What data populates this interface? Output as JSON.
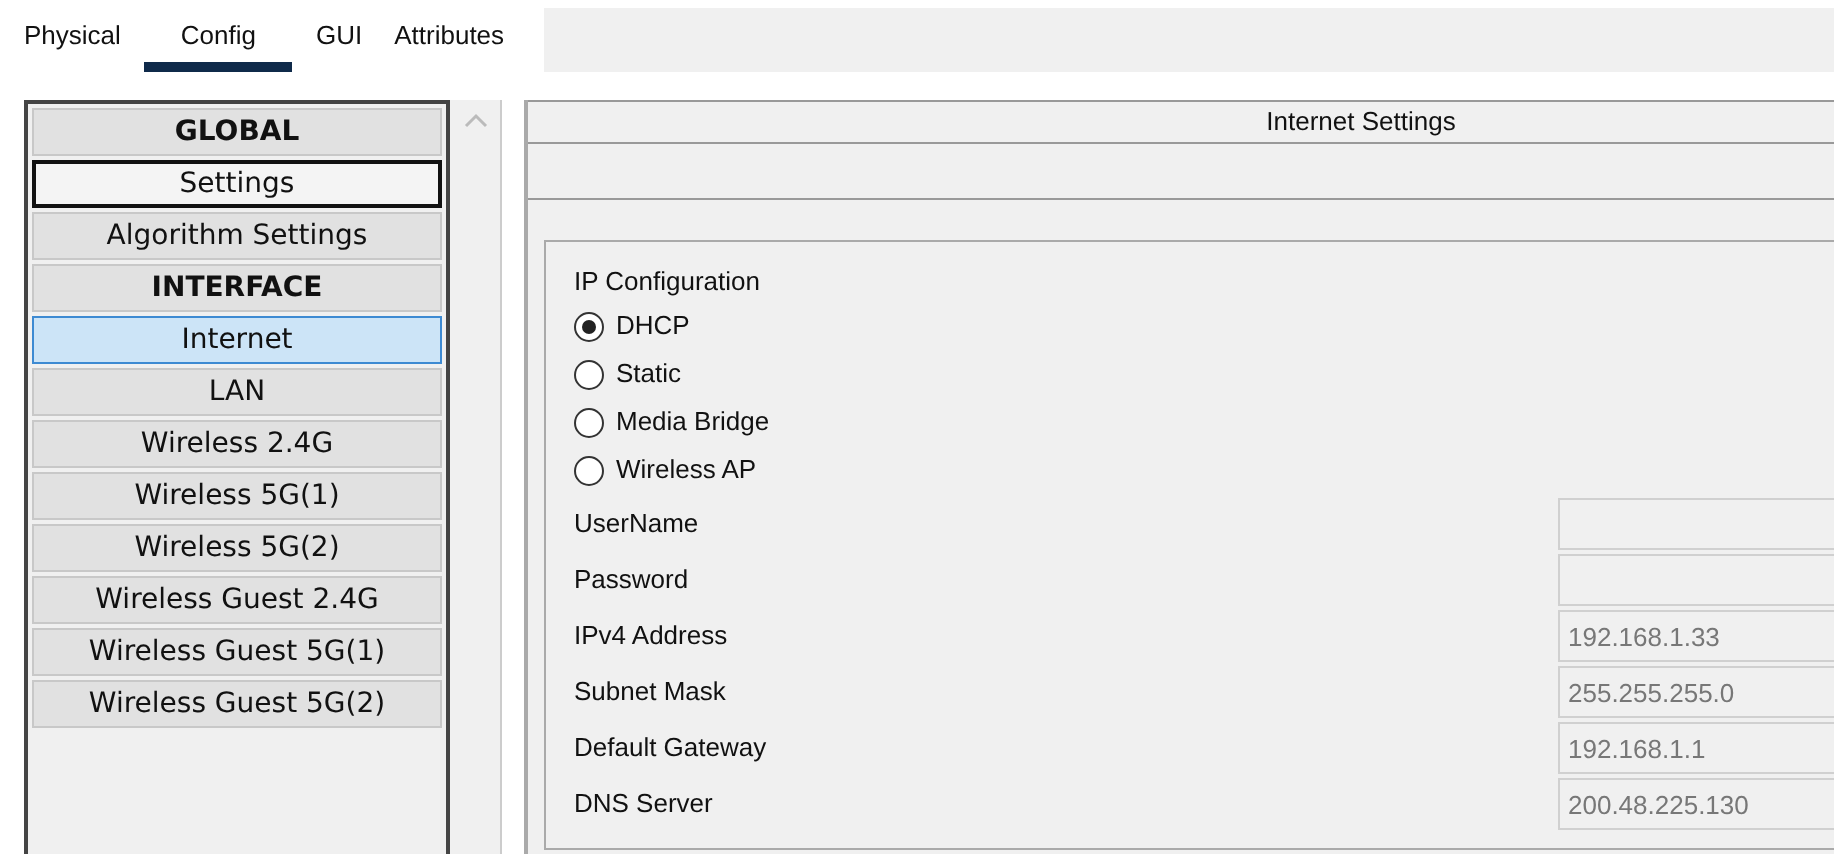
{
  "tabs": [
    {
      "label": "Physical",
      "selected": false
    },
    {
      "label": "Config",
      "selected": true
    },
    {
      "label": "GUI",
      "selected": false
    },
    {
      "label": "Attributes",
      "selected": false
    }
  ],
  "sidebar": {
    "items": [
      {
        "label": "GLOBAL",
        "kind": "header",
        "selected": false,
        "focused": false
      },
      {
        "label": "Settings",
        "kind": "item",
        "selected": false,
        "focused": true
      },
      {
        "label": "Algorithm Settings",
        "kind": "item",
        "selected": false,
        "focused": false
      },
      {
        "label": "INTERFACE",
        "kind": "header",
        "selected": false,
        "focused": false
      },
      {
        "label": "Internet",
        "kind": "item",
        "selected": true,
        "focused": false
      },
      {
        "label": "LAN",
        "kind": "item",
        "selected": false,
        "focused": false
      },
      {
        "label": "Wireless 2.4G",
        "kind": "item",
        "selected": false,
        "focused": false
      },
      {
        "label": "Wireless 5G(1)",
        "kind": "item",
        "selected": false,
        "focused": false
      },
      {
        "label": "Wireless 5G(2)",
        "kind": "item",
        "selected": false,
        "focused": false
      },
      {
        "label": "Wireless Guest 2.4G",
        "kind": "item",
        "selected": false,
        "focused": false
      },
      {
        "label": "Wireless Guest 5G(1)",
        "kind": "item",
        "selected": false,
        "focused": false
      },
      {
        "label": "Wireless Guest 5G(2)",
        "kind": "item",
        "selected": false,
        "focused": false
      }
    ]
  },
  "panel": {
    "title": "Internet Settings",
    "group": {
      "title": "IP Configuration",
      "options": [
        {
          "label": "DHCP",
          "selected": true
        },
        {
          "label": "Static",
          "selected": false
        },
        {
          "label": "Media Bridge",
          "selected": false
        },
        {
          "label": "Wireless AP",
          "selected": false
        }
      ],
      "fields": [
        {
          "label": "UserName"
        },
        {
          "label": "Password"
        },
        {
          "label": "IPv4 Address",
          "value": "192.168.1.33"
        },
        {
          "label": "Subnet Mask",
          "value": "255.255.255.0"
        },
        {
          "label": "Default Gateway",
          "value": "192.168.1.1"
        },
        {
          "label": "DNS Server",
          "value": "200.48.225.130"
        }
      ]
    }
  }
}
